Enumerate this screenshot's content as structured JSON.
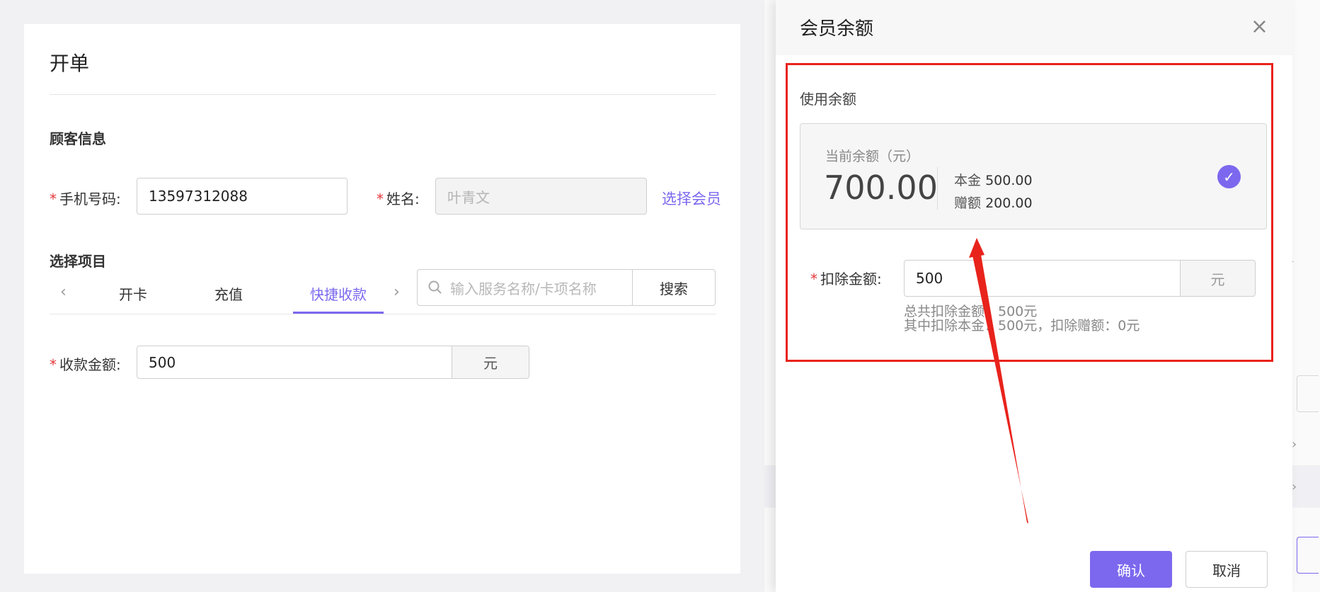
{
  "order": {
    "title": "开单",
    "customer_section": "顾客信息",
    "phone_label": "手机号码:",
    "phone_value": "13597312088",
    "name_label": "姓名:",
    "name_value": "叶青文",
    "select_member_link": "选择会员",
    "project_section": "选择项目",
    "tabs": [
      {
        "label": "开卡"
      },
      {
        "label": "充值"
      },
      {
        "label": "快捷收款",
        "active": true
      }
    ],
    "search_placeholder": "输入服务名称/卡项名称",
    "search_button": "搜索",
    "amount_label": "收款金额:",
    "amount_value": "500",
    "amount_unit": "元"
  },
  "modal": {
    "title": "会员余额",
    "use_balance_label": "使用余额",
    "current_balance_label": "当前余额（元）",
    "current_balance_value": "700.00",
    "principal_label": "本金",
    "principal_value": "500.00",
    "bonus_label": "赠额",
    "bonus_value": "200.00",
    "deduct_label": "扣除金额:",
    "deduct_value": "500",
    "deduct_unit": "元",
    "summary_line1": "总共扣除金额：500元",
    "summary_line2": "其中扣除本金：500元，扣除赠额：0元",
    "confirm_button": "确认",
    "cancel_button": "取消"
  },
  "colors": {
    "accent": "#7b68ee",
    "annotation_red": "#e8231c",
    "required_star": "#e4393c"
  },
  "icons": {
    "close": "close-icon",
    "search": "search-icon",
    "check": "check-circle-icon",
    "prev": "chevron-left-icon",
    "next": "chevron-right-icon"
  }
}
